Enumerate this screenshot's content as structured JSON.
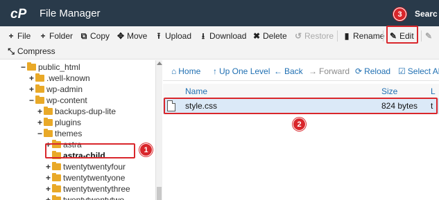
{
  "header": {
    "title": "File Manager",
    "search_label": "Searc",
    "logo_icon": "cpanel-logo-icon",
    "background": "#293a4a"
  },
  "toolbar": {
    "items": [
      {
        "label": "File",
        "icon": "plus-icon",
        "glyph": "+"
      },
      {
        "label": "Folder",
        "icon": "plus-icon",
        "glyph": "+"
      },
      {
        "label": "Copy",
        "icon": "copy-icon",
        "glyph": "⧉"
      },
      {
        "label": "Move",
        "icon": "move-icon",
        "glyph": "✥"
      },
      {
        "label": "Upload",
        "icon": "upload-icon",
        "glyph": "⭱"
      },
      {
        "label": "Download",
        "icon": "download-icon",
        "glyph": "⭳"
      },
      {
        "label": "Delete",
        "icon": "close-icon",
        "glyph": "✖"
      },
      {
        "label": "Restore",
        "icon": "undo-icon",
        "glyph": "↺"
      },
      {
        "label": "Rename",
        "icon": "file-icon",
        "glyph": "▮"
      },
      {
        "label": "Edit",
        "icon": "pencil-icon",
        "glyph": "✎"
      },
      {
        "label": "",
        "icon": "edit-icon",
        "glyph": "✎"
      },
      {
        "label": "Compress",
        "icon": "compress-icon",
        "glyph": "⤡"
      }
    ]
  },
  "tree": {
    "items": [
      {
        "label": "public_html",
        "toggle": "−"
      },
      {
        "label": ".well-known",
        "toggle": "+"
      },
      {
        "label": "wp-admin",
        "toggle": "+"
      },
      {
        "label": "wp-content",
        "toggle": "−"
      },
      {
        "label": "backups-dup-lite",
        "toggle": "+"
      },
      {
        "label": "plugins",
        "toggle": "+"
      },
      {
        "label": "themes",
        "toggle": "−"
      },
      {
        "label": "astra",
        "toggle": "+"
      },
      {
        "label": "astra-child",
        "toggle": ""
      },
      {
        "label": "twentytwentyfour",
        "toggle": "+"
      },
      {
        "label": "twentytwentyone",
        "toggle": "+"
      },
      {
        "label": "twentytwentythree",
        "toggle": "+"
      },
      {
        "label": "twentytwentytwo",
        "toggle": "+"
      }
    ]
  },
  "nav": {
    "items": [
      {
        "label": "Home",
        "icon": "home-icon",
        "glyph": "⌂"
      },
      {
        "label": "Up One Level",
        "icon": "level-up-icon",
        "glyph": "↑"
      },
      {
        "label": "Back",
        "icon": "arrow-left-icon",
        "glyph": "←"
      },
      {
        "label": "Forward",
        "icon": "arrow-right-icon",
        "glyph": "→"
      },
      {
        "label": "Reload",
        "icon": "reload-icon",
        "glyph": "⟳"
      },
      {
        "label": "Select All",
        "icon": "checkbox-icon",
        "glyph": "☑"
      }
    ]
  },
  "grid": {
    "columns": [
      "Name",
      "Size",
      "L"
    ],
    "rows": [
      {
        "name": "style.css",
        "size": "824 bytes",
        "extra": "t",
        "icon": "css-file-icon"
      }
    ]
  },
  "annotations": {
    "badges": [
      "1",
      "2",
      "3"
    ],
    "color": "#d9262b"
  }
}
